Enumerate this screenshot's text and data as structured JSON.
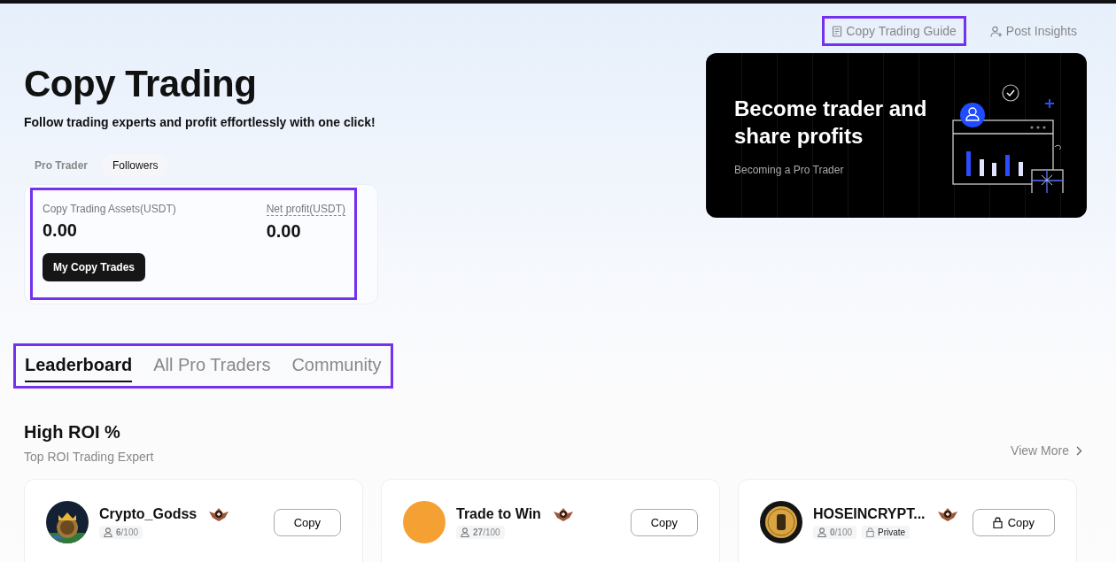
{
  "header_links": [
    {
      "label": "Copy Trading Guide",
      "kind": "guide",
      "highlighted": true
    },
    {
      "label": "Post Insights",
      "kind": "insights",
      "highlighted": false
    }
  ],
  "title": "Copy Trading",
  "subtitle": "Follow trading experts and profit effortlessly with one click!",
  "role_tabs": [
    {
      "label": "Pro Trader",
      "selected": false
    },
    {
      "label": "Followers",
      "selected": true
    }
  ],
  "summary": {
    "highlighted": true,
    "assets_label": "Copy Trading Assets(USDT)",
    "assets_value": "0.00",
    "profit_label": "Net profit(USDT)",
    "profit_value": "0.00",
    "button": "My Copy Trades"
  },
  "banner": {
    "title": "Become trader and share profits",
    "subtitle": "Becoming a Pro Trader"
  },
  "section_tabs": {
    "highlighted": true,
    "items": [
      {
        "label": "Leaderboard",
        "selected": true
      },
      {
        "label": "All Pro Traders",
        "selected": false
      },
      {
        "label": "Community",
        "selected": false
      }
    ]
  },
  "section": {
    "title": "High ROI %",
    "subtitle": "Top ROI Trading Expert",
    "view_more": "View More"
  },
  "traders": [
    {
      "name": "Crypto_Godss",
      "kind": "crown-coin",
      "followers": "**6**/100",
      "private": false,
      "button": "Copy"
    },
    {
      "name": "Trade to Win",
      "kind": "plain",
      "followers": "**27**/100",
      "private": false,
      "button": "Copy"
    },
    {
      "name": "HOSEINCRYPT...",
      "kind": "coin",
      "followers": "**0**/100",
      "private": true,
      "private_label": "Private",
      "button": "Copy"
    }
  ]
}
